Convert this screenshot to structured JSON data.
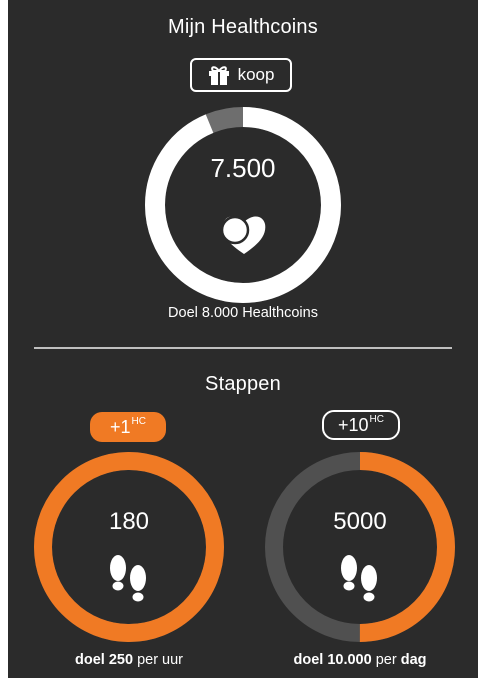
{
  "healthcoins": {
    "title": "Mijn Healthcoins",
    "buy_label": "koop",
    "value": "7.500",
    "progress": 0.9375,
    "goal_text": "Doel 8.000 Healthcoins"
  },
  "steps": {
    "title": "Stappen",
    "hourly": {
      "badge_value": "+1",
      "badge_unit": "HC",
      "value": "180",
      "progress": 1.0,
      "goal_prefix": "doel",
      "goal_number": "250",
      "goal_suffix": "per uur"
    },
    "daily": {
      "badge_value": "+10",
      "badge_unit": "HC",
      "value": "5000",
      "progress": 0.5,
      "goal_prefix": "doel 10.000",
      "goal_middle": "per",
      "goal_suffix": "dag"
    }
  },
  "colors": {
    "panel": "#2b2b2b",
    "accent": "#f07a24",
    "ring_track_gray": "#505050",
    "ring_track_light": "#6e6e6e",
    "white": "#ffffff"
  },
  "icons": {
    "buy": "gift-icon",
    "coin": "heart-coin-icon",
    "steps": "footprints-icon"
  }
}
